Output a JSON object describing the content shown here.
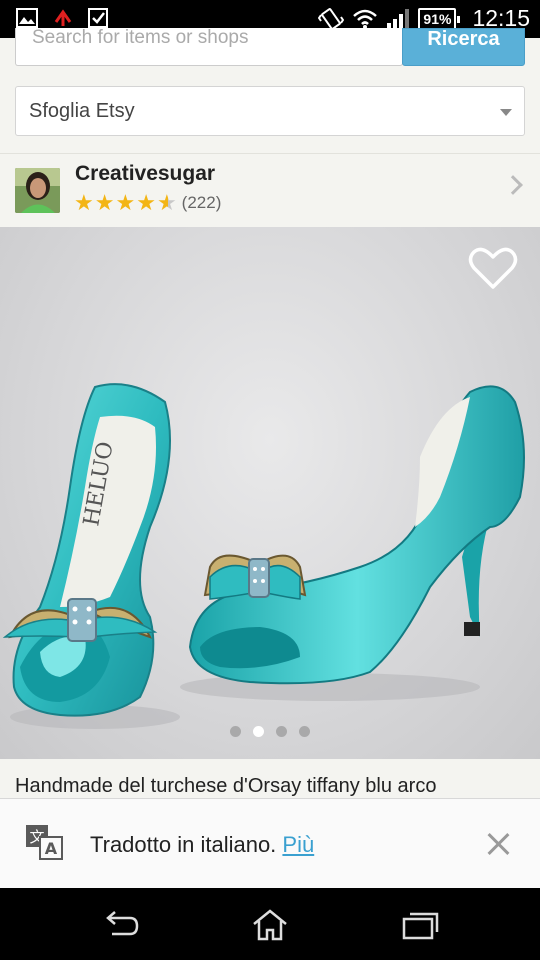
{
  "status_bar": {
    "battery": "91%",
    "time": "12:15",
    "icons": [
      "gallery-icon",
      "usb-icon",
      "checkbox-icon",
      "vibrate-icon",
      "wifi-icon",
      "signal-icon",
      "battery-icon"
    ]
  },
  "search": {
    "placeholder": "Search for items or shops",
    "button_label": "Ricerca"
  },
  "browse": {
    "label": "Sfoglia Etsy"
  },
  "shop": {
    "name": "Creativesugar",
    "rating": 4.5,
    "review_count": "(222)"
  },
  "listing": {
    "image_count": 4,
    "active_image_index": 1,
    "title": "Handmade del turchese d'Orsay tiffany blu arco"
  },
  "translation": {
    "message": "Tradotto in italiano.",
    "more_label": "Più"
  },
  "colors": {
    "accent": "#5ab0d8",
    "star": "#f3b515",
    "shoe": "#3cc6c6"
  }
}
